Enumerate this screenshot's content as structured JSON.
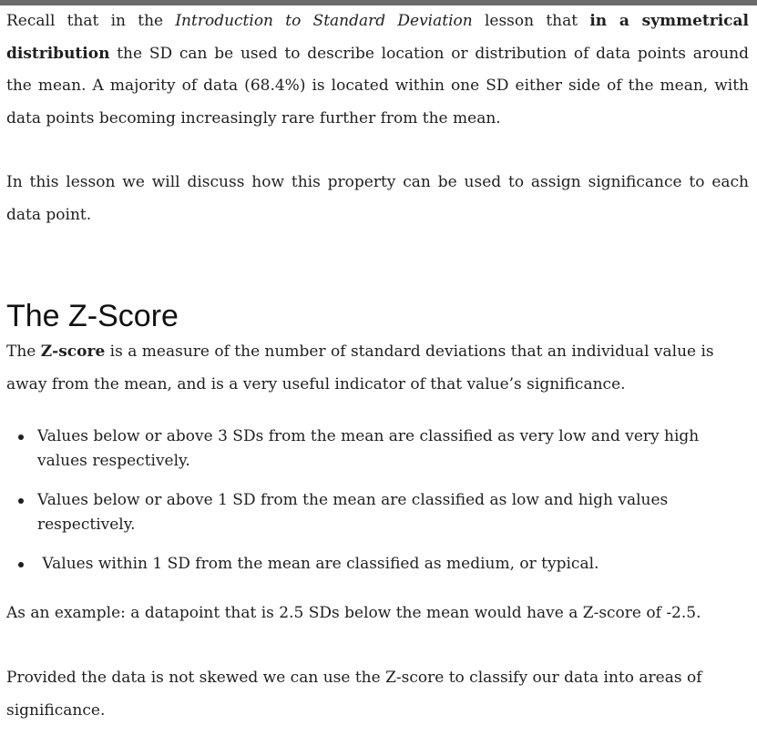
{
  "intro": {
    "p1_a": "Recall that in the ",
    "p1_lesson": "Introduction to Standard Deviation",
    "p1_b": " lesson that ",
    "p1_bold": "in a symmetrical distribution",
    "p1_c": " the SD can be used to describe location or distribution of data points around the mean. A majority of data (68.4%) is located within one SD either side of the mean, with data points becoming increasingly rare further from the mean.",
    "p2": "In this lesson we will discuss how this property can be used to assign significance to each data point."
  },
  "section": {
    "title": "The Z-Score",
    "def_a": "The ",
    "def_bold": "Z-score",
    "def_b": " is a measure of the number of standard deviations that an individual value is away from the mean, and is a very useful indicator of that value’s significance."
  },
  "bullets": [
    "Values below or above 3 SDs from the mean are classified as very low and very high values respectively.",
    "Values below or above 1 SD from the mean are classified as low and high values respectively.",
    " Values within 1 SD from the mean are classified as medium, or typical."
  ],
  "example": "As an example: a datapoint that is 2.5 SDs below the mean would have a Z-score of -2.5.",
  "closing": "Provided the data is not skewed we can use the Z-score to classify our data into areas of significance."
}
